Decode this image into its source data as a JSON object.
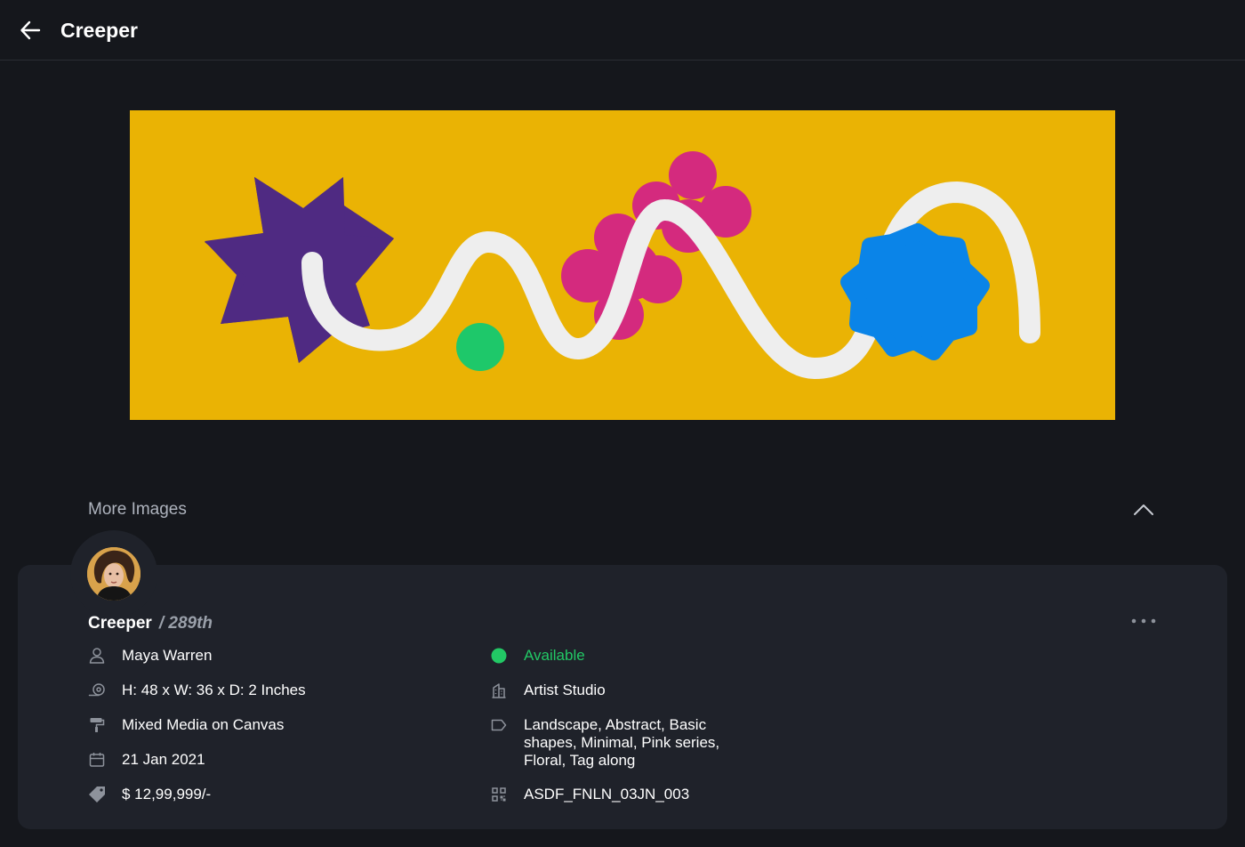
{
  "header": {
    "title": "Creeper"
  },
  "artwork": {
    "background": "#eab304",
    "colors": {
      "star": "#4f2a82",
      "flower": "#d42a7e",
      "dot": "#1ec86a",
      "badge": "#0a84e8",
      "line": "#eeeeee"
    }
  },
  "more_images": {
    "label": "More Images",
    "toggle_icon": "chevron-up-icon"
  },
  "details": {
    "title": "Creeper",
    "edition": "/ 289th",
    "more_icon": "more-horizontal-icon",
    "artist": "Maya Warren",
    "dimensions": "H: 48 x W: 36 x D: 2 Inches",
    "medium": "Mixed Media on Canvas",
    "date": "21 Jan 2021",
    "price": "$ 12,99,999/-",
    "status": "Available",
    "status_color": "#22c865",
    "location": "Artist Studio",
    "tags": "Landscape, Abstract, Basic shapes, Minimal, Pink series, Floral, Tag along",
    "code": "ASDF_FNLN_03JN_003"
  }
}
